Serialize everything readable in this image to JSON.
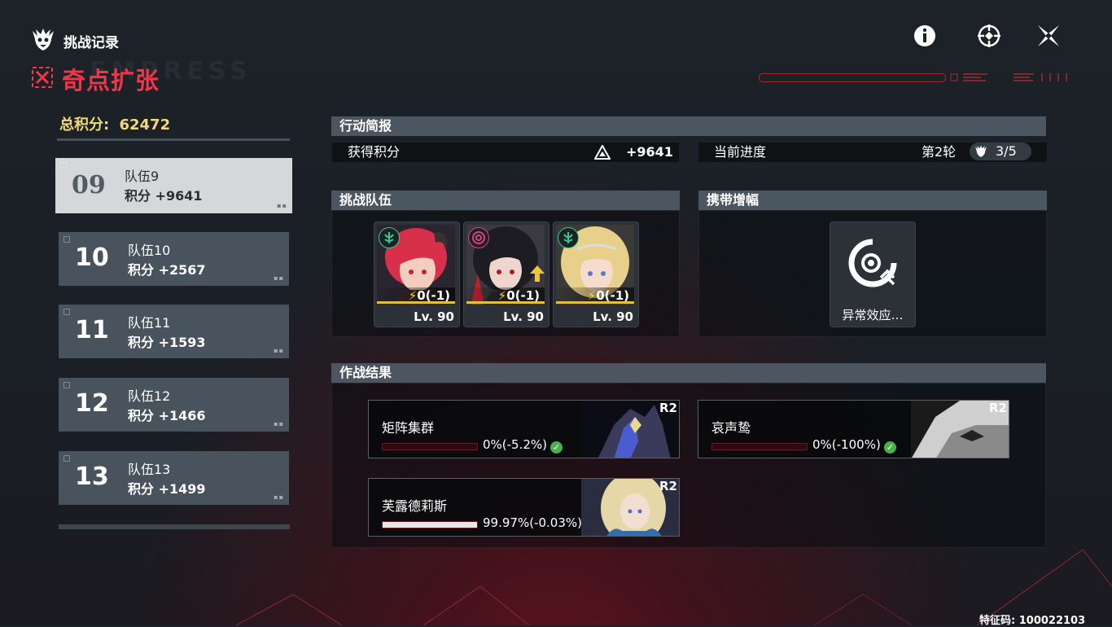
{
  "header": {
    "title": "挑战记录",
    "mode_title": "奇点扩张",
    "bg_deco_text": "EMPRESS"
  },
  "top_buttons": [
    {
      "name": "info",
      "icon": "info-icon"
    },
    {
      "name": "target",
      "icon": "crosshair-icon"
    },
    {
      "name": "close",
      "icon": "close-icon"
    }
  ],
  "left": {
    "total_label": "总积分:",
    "total_value": "62472",
    "teams": [
      {
        "num": "09",
        "name": "队伍9",
        "score": "积分 +9641",
        "selected": true
      },
      {
        "num": "10",
        "name": "队伍10",
        "score": "积分 +2567",
        "selected": false
      },
      {
        "num": "11",
        "name": "队伍11",
        "score": "积分 +1593",
        "selected": false
      },
      {
        "num": "12",
        "name": "队伍12",
        "score": "积分 +1466",
        "selected": false
      },
      {
        "num": "13",
        "name": "队伍13",
        "score": "积分 +1499",
        "selected": false
      }
    ]
  },
  "brief": {
    "header": "行动简报",
    "score_label": "获得积分",
    "score_value": "+9641",
    "progress_label": "当前进度",
    "round": "第2轮",
    "progress": "3/5"
  },
  "team_section": {
    "header": "挑战队伍",
    "members": [
      {
        "energy": "0(-1)",
        "level": "Lv. 90",
        "element_color": "#3ac98c",
        "hair": "#d8304a",
        "skin": "#f3cdbe",
        "arrow": false
      },
      {
        "energy": "0(-1)",
        "level": "Lv. 90",
        "element_color": "#e0407a",
        "hair": "#1c1c22",
        "skin": "#eed6cf",
        "arrow": true
      },
      {
        "energy": "0(-1)",
        "level": "Lv. 90",
        "element_color": "#3ac98c",
        "hair": "#e8cf8a",
        "skin": "#f6dccc",
        "arrow": false
      }
    ]
  },
  "buff_section": {
    "header": "携带增幅",
    "item_label": "异常效应…"
  },
  "results": {
    "header": "作战结果",
    "bosses": [
      {
        "name": "矩阵集群",
        "rank": "R2",
        "hp_fraction": 0,
        "pct": "0%(-5.2%)",
        "cleared": true
      },
      {
        "name": "哀声鸷",
        "rank": "R2",
        "hp_fraction": 0,
        "pct": "0%(-100%)",
        "cleared": true
      },
      {
        "name": "芙露德莉斯",
        "rank": "R2",
        "hp_fraction": 0.9997,
        "pct": "99.97%(-0.03%)",
        "cleared": false
      }
    ]
  },
  "footer": {
    "feature_code": "特征码: 100022103"
  }
}
